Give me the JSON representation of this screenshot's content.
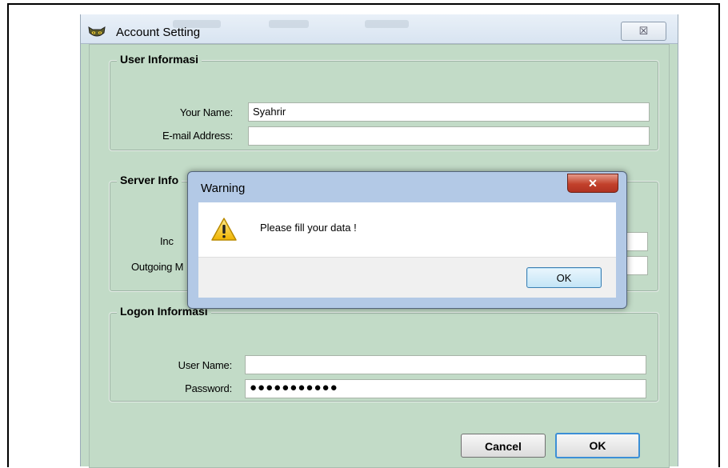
{
  "window": {
    "title": "Account Setting",
    "close_glyph": "☒"
  },
  "user_group": {
    "title": "User Informasi",
    "name_label": "Your Name:",
    "name_value": "Syahrir",
    "email_label": "E-mail Address:",
    "email_value": ""
  },
  "server_group": {
    "title": "Server Info",
    "incoming_label": "Inc",
    "outgoing_label": "Outgoing M"
  },
  "logon_group": {
    "title": "Logon Informasi",
    "username_label": "User Name:",
    "username_value": "",
    "password_label": "Password:",
    "password_value": "●●●●●●●●●●●"
  },
  "buttons": {
    "cancel": "Cancel",
    "ok": "OK"
  },
  "warning": {
    "title": "Warning",
    "close_glyph": "✕",
    "message": "Please fill your data !",
    "ok": "OK"
  },
  "colors": {
    "window_bg": "#c2dbc7",
    "dialog_frame": "#b3c9e6",
    "default_button_border": "#3c8fd6",
    "close_button": "#c2412b"
  },
  "icons": {
    "app": "cat-face-icon",
    "warning": "warning-triangle-icon"
  }
}
